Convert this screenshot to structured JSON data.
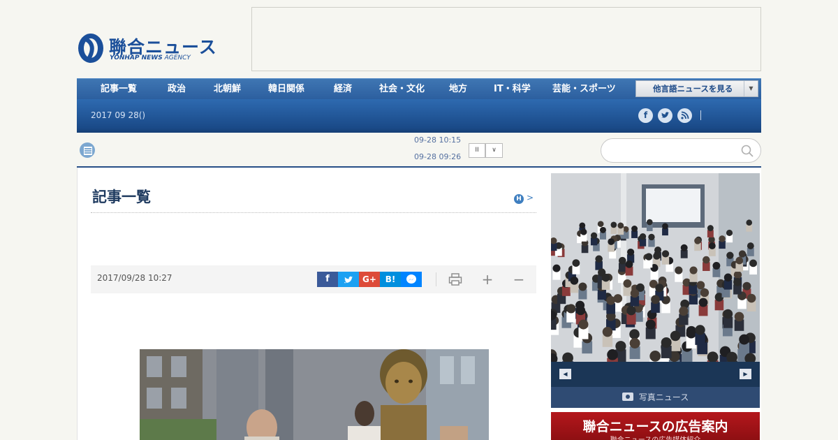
{
  "logo": {
    "jp": "聯合ニュース",
    "en_bold": "YONHAP NEWS",
    "en_light": " AGENCY"
  },
  "nav": {
    "items": [
      "記事一覧",
      "政治",
      "北朝鮮",
      "韓日関係",
      "経済",
      "社会・文化",
      "地方",
      "IT・科学",
      "芸能・スポーツ"
    ],
    "language_button": "他言語ニュースを見る"
  },
  "subbar": {
    "date": "2017 09 28()"
  },
  "social": {
    "facebook": "f",
    "twitter": "t",
    "rss": "rss"
  },
  "ticker": {
    "times": [
      "09-28 10:15",
      "09-28 09:26"
    ],
    "pause": "II",
    "next": "∨"
  },
  "search": {
    "placeholder": "",
    "value": ""
  },
  "article": {
    "section_title": "記事一覧",
    "history_badge": "H",
    "history_arrow": ">",
    "datetime": "2017/09/28 10:27",
    "share": {
      "facebook": "f",
      "twitter": "t",
      "googleplus": "G+",
      "hatena": "B!",
      "messenger": "m"
    },
    "tools": {
      "plus": "+",
      "minus": "−"
    }
  },
  "sidebar": {
    "photo_caption": "写真ニュース",
    "prev": "◀",
    "next": "▶",
    "ad_title": "聯合ニュースの広告案内",
    "ad_sub": "聯合ニュースの広告媒体紹介"
  },
  "colors": {
    "brand": "#1b4f9a",
    "nav": "#2c5f9f",
    "subbar": "#1a4a88",
    "ad_red": "#b4171c"
  },
  "icons": [
    "logo-mark-icon",
    "ticker-list-icon",
    "search-icon",
    "facebook-icon",
    "twitter-icon",
    "rss-icon",
    "print-icon",
    "camera-icon"
  ]
}
